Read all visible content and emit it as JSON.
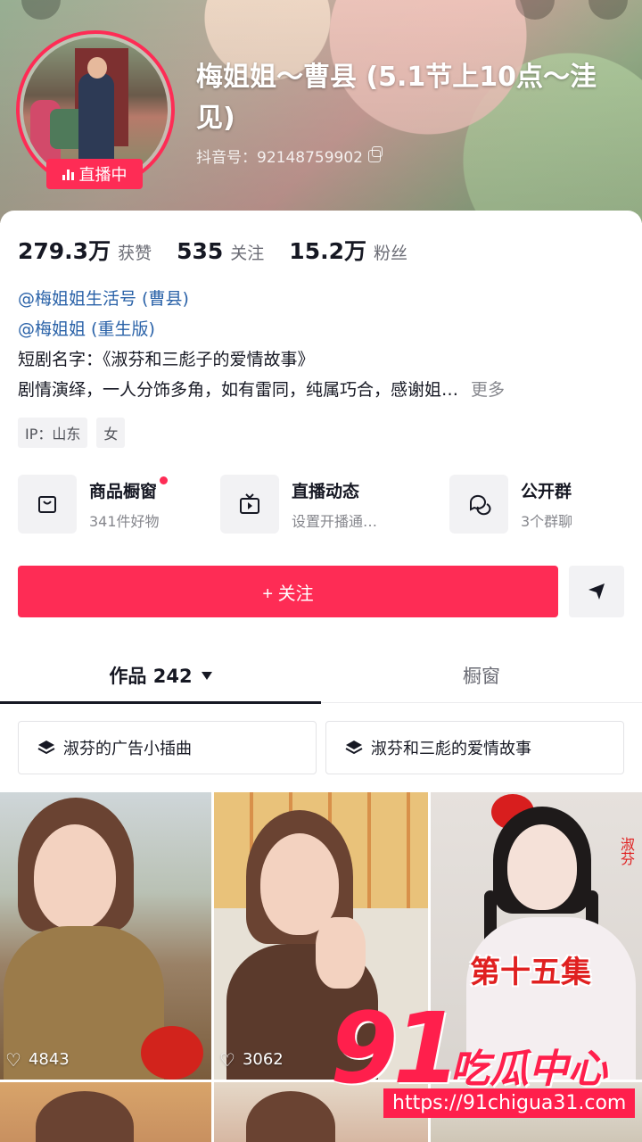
{
  "header": {
    "live_badge": "直播中",
    "name": "梅姐姐～曹县 (5.1节上10点～洼见)",
    "douyin_id": "抖音号：92148759902"
  },
  "stats": [
    {
      "value": "279.3万",
      "label": "获赞"
    },
    {
      "value": "535",
      "label": "关注"
    },
    {
      "value": "15.2万",
      "label": "粉丝"
    }
  ],
  "bio": {
    "link1": "@梅姐姐生活号 (曹县)",
    "link2": "@梅姐姐 (重生版)",
    "line3": "短剧名字：《淑芬和三彪子的爱情故事》",
    "line4": "剧情演绎，一人分饰多角，如有雷同，纯属巧合，感谢姐…",
    "more": "更多"
  },
  "tags": [
    "IP：山东",
    "女"
  ],
  "shortcuts": [
    {
      "title": "商品橱窗",
      "sub": "341件好物",
      "icon": "shop-bag-icon"
    },
    {
      "title": "直播动态",
      "sub": "设置开播通…",
      "icon": "tv-icon"
    },
    {
      "title": "公开群",
      "sub": "3个群聊",
      "icon": "chat-bubbles-icon"
    }
  ],
  "follow_label": "+ 关注",
  "tabs": {
    "works": "作品 242",
    "showcase": "橱窗"
  },
  "collections": [
    "淑芬的广告小插曲",
    "淑芬和三彪的爱情故事"
  ],
  "videos": [
    {
      "likes": "4843"
    },
    {
      "likes": "3062"
    },
    {
      "overlay": "第十五集",
      "side": "淑芬"
    }
  ],
  "watermark": {
    "big": "91",
    "text": "吃瓜中心",
    "url": "https://91chigua31.com"
  },
  "colors": {
    "accent": "#fe2c55",
    "link": "#2a62a8"
  }
}
